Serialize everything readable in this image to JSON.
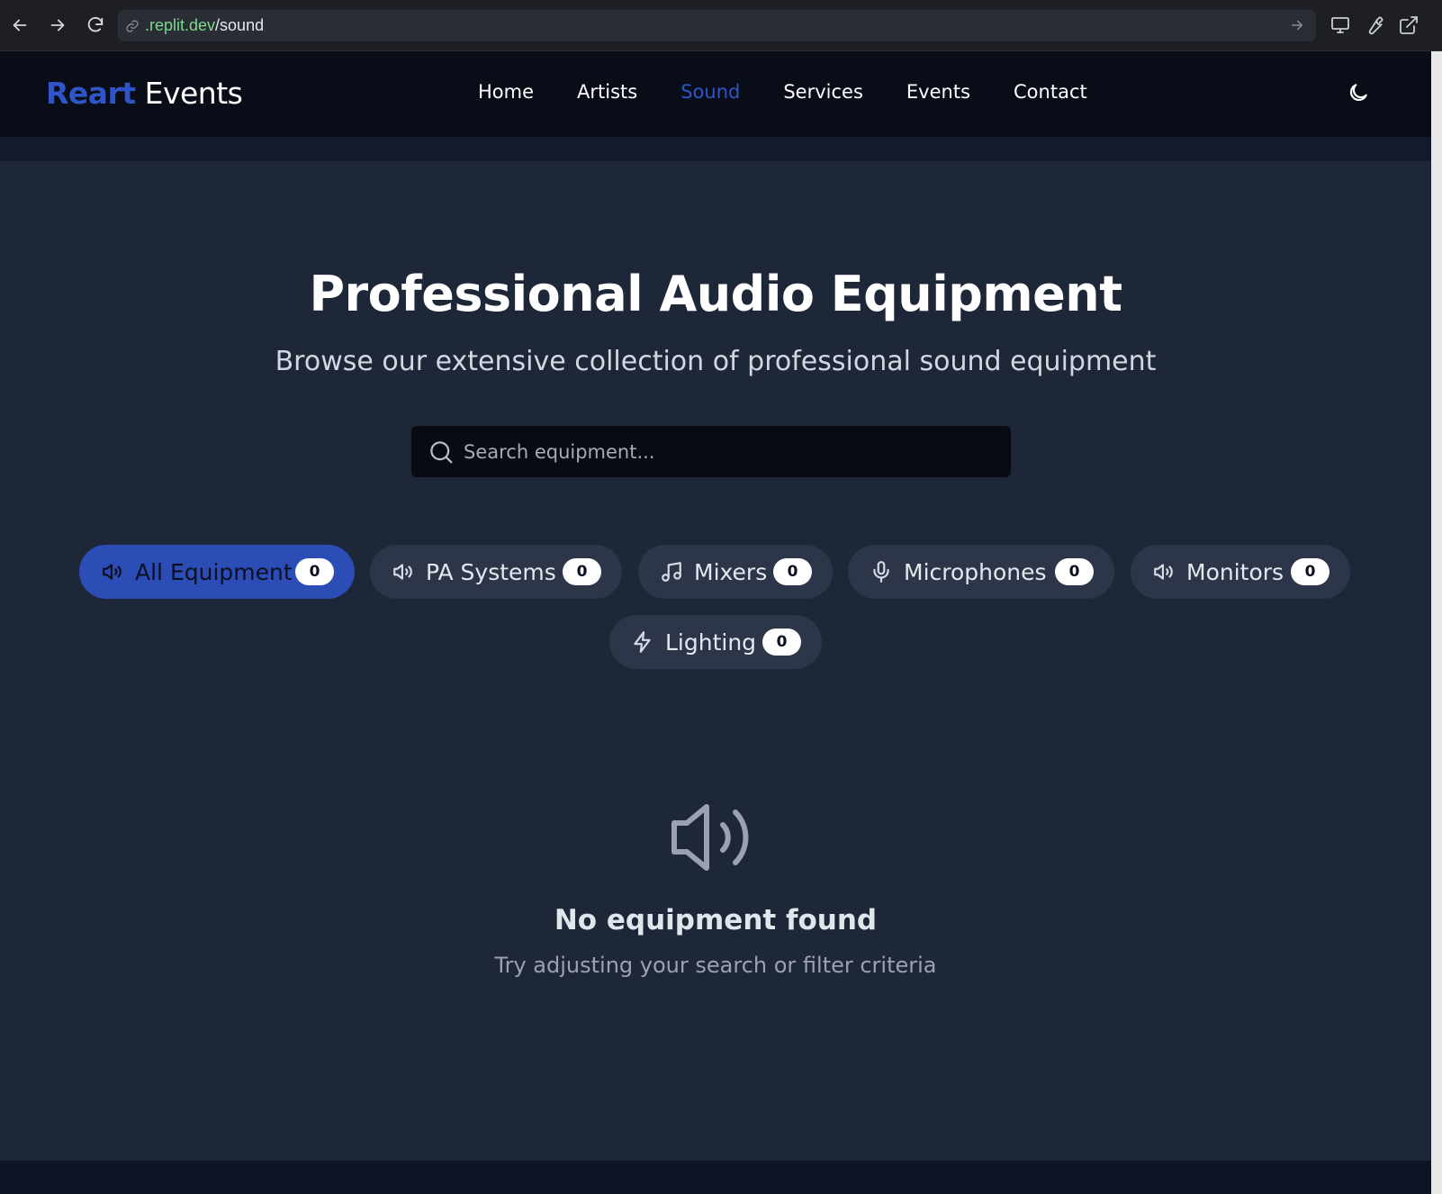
{
  "browser": {
    "url_host": ".replit.dev",
    "url_path": "/sound"
  },
  "header": {
    "logo_brand": "Reart",
    "logo_rest": "Events",
    "nav": [
      {
        "label": "Home"
      },
      {
        "label": "Artists"
      },
      {
        "label": "Sound"
      },
      {
        "label": "Services"
      },
      {
        "label": "Events"
      },
      {
        "label": "Contact"
      }
    ],
    "active_nav": "Sound",
    "theme_icon": "moon-icon"
  },
  "hero": {
    "title": "Professional Audio Equipment",
    "subtitle": "Browse our extensive collection of professional sound equipment"
  },
  "search": {
    "placeholder": "Search equipment...",
    "value": ""
  },
  "filters": [
    {
      "label": "All Equipment",
      "count": "0",
      "icon": "speaker-icon",
      "active": true
    },
    {
      "label": "PA Systems",
      "count": "0",
      "icon": "speaker-icon",
      "active": false
    },
    {
      "label": "Mixers",
      "count": "0",
      "icon": "music-note-icon",
      "active": false
    },
    {
      "label": "Microphones",
      "count": "0",
      "icon": "microphone-icon",
      "active": false
    },
    {
      "label": "Monitors",
      "count": "0",
      "icon": "speaker-icon",
      "active": false
    },
    {
      "label": "Lighting",
      "count": "0",
      "icon": "lightning-icon",
      "active": false
    }
  ],
  "empty_state": {
    "icon": "speaker-icon",
    "title": "No equipment found",
    "text": "Try adjusting your search or filter criteria"
  },
  "colors": {
    "accent": "#2f55c8",
    "page_bg": "#1e2738",
    "header_bg": "#090d17",
    "chip_bg": "#2d3648"
  }
}
